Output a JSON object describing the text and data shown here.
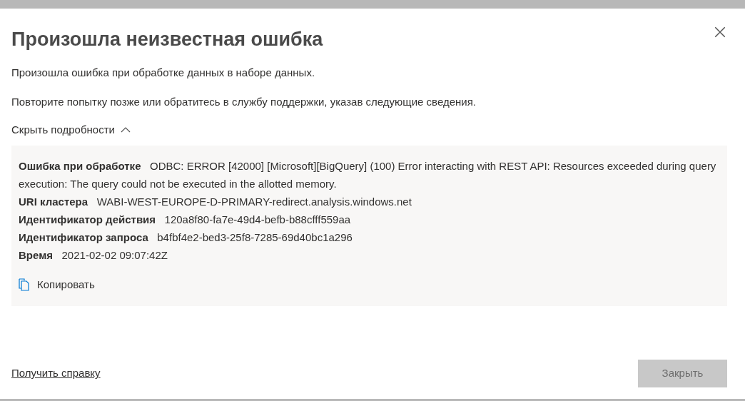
{
  "dialog": {
    "title": "Произошла неизвестная ошибка",
    "messages": [
      "Произошла ошибка при обработке данных в наборе данных.",
      "Повторите попытку позже или обратитесь в службу поддержки, указав следующие сведения."
    ],
    "details_toggle": {
      "label": "Скрыть подробности",
      "expanded": true
    },
    "details": [
      {
        "label": "Ошибка при обработке",
        "value": "ODBC: ERROR [42000] [Microsoft][BigQuery] (100) Error interacting with REST API: Resources exceeded during query execution: The query could not be executed in the allotted memory."
      },
      {
        "label": "URI кластера",
        "value": "WABI-WEST-EUROPE-D-PRIMARY-redirect.analysis.windows.net"
      },
      {
        "label": "Идентификатор действия",
        "value": "120a8f80-fa7e-49d4-befb-b88cfff559aa"
      },
      {
        "label": "Идентификатор запроса",
        "value": "b4fbf4e2-bed3-25f8-7285-69d40bc1a296"
      },
      {
        "label": "Время",
        "value": "2021-02-02 09:07:42Z"
      }
    ],
    "copy_button": "Копировать",
    "help_link": "Получить справку",
    "close_button": {
      "label": "Закрыть",
      "disabled": true
    }
  }
}
